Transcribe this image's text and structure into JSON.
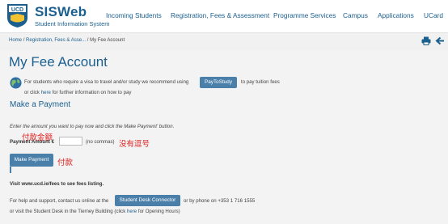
{
  "header": {
    "brand_title": "SISWeb",
    "brand_subtitle": "Student Information System",
    "crest_text": "UCD",
    "nav": [
      "Incoming Students",
      "Registration, Fees & Assessment",
      "Programme Services",
      "Campus",
      "Applications",
      "UCard"
    ]
  },
  "breadcrumb": {
    "home": "Home",
    "sep1": "/",
    "section": "Registration, Fees & Asse...",
    "sep2": "/",
    "current": "My Fee Account"
  },
  "page": {
    "title": "My Fee Account",
    "visa_text_before": "For students who require a visa to travel and/or study we recommend using",
    "paytostudy_label": "PayToStudy",
    "visa_text_after": "to pay tuition fees",
    "click_prefix": "or click",
    "here_link": "here",
    "click_suffix": "for further information on how to pay",
    "section_title": "Make a Payment",
    "instruction": "Enter the amount you want to pay now and click the Make Payment' button.",
    "amount_label": "Payment Amount €",
    "amount_value": "",
    "no_commas": "(no commas)",
    "make_payment_label": "Make Payment",
    "visit_text": "Visit www.ucd.ie/fees to see fees listing.",
    "help_before": "For help and support, contact us online at the",
    "desk_connector_label": "Student Desk Connector",
    "help_after": "or by phone on +353 1 716 1555",
    "visit_desk_before": "or visit the Student Desk in the Tierney Building (click",
    "visit_desk_link": "here",
    "visit_desk_after": "for Opening Hours)"
  },
  "annotations": {
    "amount_note": "付款金额",
    "no_commas_note": "没有逗号",
    "pay_note": "付款"
  },
  "icons": {
    "print": "print-icon",
    "back": "back-arrow-icon",
    "globe": "globe-icon",
    "crest": "ucd-crest-icon"
  },
  "colors": {
    "brand": "#1b5f8f",
    "button": "#4a7fa9",
    "annotation": "#e02020",
    "content_bg": "#f3f3f3"
  }
}
